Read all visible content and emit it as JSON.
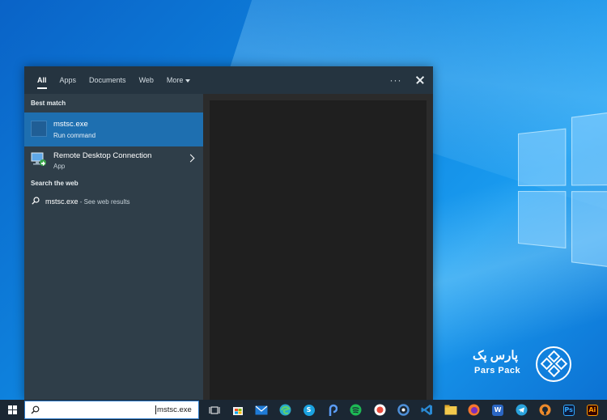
{
  "search_panel": {
    "tabs": [
      {
        "label": "All",
        "active": true
      },
      {
        "label": "Apps"
      },
      {
        "label": "Documents"
      },
      {
        "label": "Web"
      },
      {
        "label": "More"
      }
    ],
    "more_icon": "ellipsis-icon",
    "close_icon": "close-icon",
    "best_match": {
      "header": "Best match",
      "title": "mstsc.exe",
      "subtitle": "Run command"
    },
    "apps": [
      {
        "title": "Remote Desktop Connection",
        "subtitle": "App",
        "icon": "remote-desktop-icon"
      }
    ],
    "web": {
      "header": "Search the web",
      "query": "mstsc.exe",
      "suffix": " - See web results"
    }
  },
  "logo": {
    "persian": "پارس پک",
    "english": "Pars Pack"
  },
  "taskbar": {
    "search_value": "mstsc.exe",
    "icons": [
      {
        "name": "task-view-icon",
        "color": "#1b2733"
      },
      {
        "name": "store-icon",
        "color": "#f3f3f3"
      },
      {
        "name": "mail-icon",
        "color": "#1f7bd6"
      },
      {
        "name": "edge-icon",
        "color": "#29a8c9"
      },
      {
        "name": "skype-icon",
        "color": "#1aa2e0",
        "glyph": "S"
      },
      {
        "name": "picsart-icon",
        "color": "#3b82f6"
      },
      {
        "name": "spotify-icon",
        "color": "#1db954"
      },
      {
        "name": "record-icon",
        "color": "#e94b3c"
      },
      {
        "name": "app-ring-icon",
        "color": "#2f4a6e"
      },
      {
        "name": "vscode-icon",
        "color": "#2a8ad4"
      },
      {
        "name": "file-explorer-icon",
        "color": "#f2c94c"
      },
      {
        "name": "firefox-icon",
        "color": "#f5762d"
      },
      {
        "name": "word-icon",
        "color": "#2b66c3",
        "glyph": "W"
      },
      {
        "name": "telegram-icon",
        "color": "#2aa3dd"
      },
      {
        "name": "github-icon",
        "color": "#ee8a2a"
      },
      {
        "name": "photoshop-icon",
        "color": "#1a2b4d",
        "glyph": "Ps"
      },
      {
        "name": "illustrator-icon",
        "color": "#3a1200",
        "glyph": "Ai"
      }
    ]
  }
}
